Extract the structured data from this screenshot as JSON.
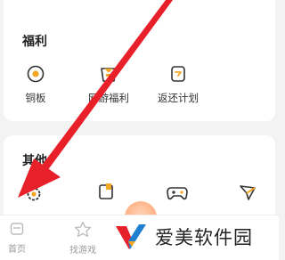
{
  "welfare": {
    "title": "福利",
    "items": [
      {
        "label": "铜板",
        "icon": "coin-icon"
      },
      {
        "label": "网游福利",
        "icon": "gift-bag-icon"
      },
      {
        "label": "返还计划",
        "icon": "return-plan-icon"
      }
    ]
  },
  "other": {
    "title": "其他",
    "items": [
      {
        "icon": "settings-icon"
      },
      {
        "icon": "orange-card-icon"
      },
      {
        "icon": "gamepad-icon"
      },
      {
        "icon": "feedback-icon"
      }
    ]
  },
  "bottom_nav": [
    {
      "label": "首页",
      "icon": "home-icon"
    },
    {
      "label": "找游戏",
      "icon": "star-icon"
    }
  ],
  "watermark": {
    "text": "爱美软件园"
  },
  "colors": {
    "accent": "#f5a623",
    "arrow": "#e8202a",
    "background": "#f3f3f3"
  }
}
